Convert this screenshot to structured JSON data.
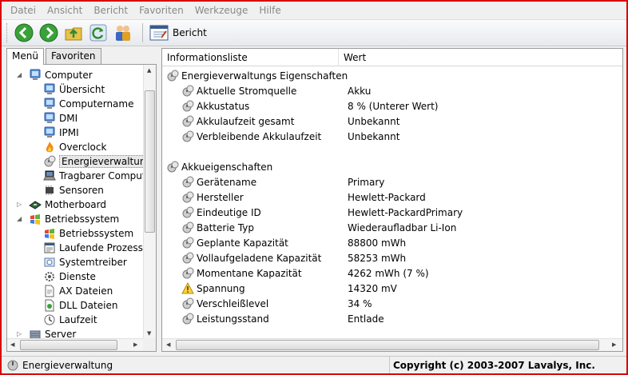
{
  "menubar": [
    "Datei",
    "Ansicht",
    "Bericht",
    "Favoriten",
    "Werkzeuge",
    "Hilfe"
  ],
  "toolbar": {
    "report_label": "Bericht"
  },
  "tabs": {
    "menu": "Menü",
    "favorites": "Favoriten"
  },
  "tree": [
    {
      "label": "Computer",
      "icon": "computer-icon",
      "level": 0,
      "exp": "minus"
    },
    {
      "label": "Übersicht",
      "icon": "computer-icon",
      "level": 1
    },
    {
      "label": "Computername",
      "icon": "computer-icon",
      "level": 1
    },
    {
      "label": "DMI",
      "icon": "computer-icon",
      "level": 1
    },
    {
      "label": "IPMI",
      "icon": "computer-icon",
      "level": 1
    },
    {
      "label": "Overclock",
      "icon": "flame-icon",
      "level": 1
    },
    {
      "label": "Energieverwaltung",
      "icon": "power-icon",
      "level": 1,
      "selected": true
    },
    {
      "label": "Tragbarer Compute",
      "icon": "laptop-icon",
      "level": 1
    },
    {
      "label": "Sensoren",
      "icon": "chip-icon",
      "level": 1
    },
    {
      "label": "Motherboard",
      "icon": "motherboard-icon",
      "level": 0,
      "exp": "plus"
    },
    {
      "label": "Betriebssystem",
      "icon": "windows-icon",
      "level": 0,
      "exp": "minus"
    },
    {
      "label": "Betriebssystem",
      "icon": "windows-icon",
      "level": 1
    },
    {
      "label": "Laufende Prozesse",
      "icon": "process-icon",
      "level": 1
    },
    {
      "label": "Systemtreiber",
      "icon": "driver-icon",
      "level": 1
    },
    {
      "label": "Dienste",
      "icon": "gear-icon",
      "level": 1
    },
    {
      "label": "AX Dateien",
      "icon": "file-icon",
      "level": 1
    },
    {
      "label": "DLL Dateien",
      "icon": "dll-icon",
      "level": 1
    },
    {
      "label": "Laufzeit",
      "icon": "clock-icon",
      "level": 1
    },
    {
      "label": "Server",
      "icon": "server-icon",
      "level": 0,
      "exp": "plus"
    }
  ],
  "list": {
    "col_info": "Informationsliste",
    "col_value": "Wert",
    "rows": [
      {
        "type": "group",
        "label": "Energieverwaltungs Eigenschaften",
        "icon": "power-icon"
      },
      {
        "type": "item",
        "label": "Aktuelle Stromquelle",
        "value": "Akku",
        "icon": "power-icon"
      },
      {
        "type": "item",
        "label": "Akkustatus",
        "value": "8 % (Unterer Wert)",
        "icon": "power-icon"
      },
      {
        "type": "item",
        "label": "Akkulaufzeit gesamt",
        "value": "Unbekannt",
        "icon": "power-icon"
      },
      {
        "type": "item",
        "label": "Verbleibende Akkulaufzeit",
        "value": "Unbekannt",
        "icon": "power-icon"
      },
      {
        "type": "blank"
      },
      {
        "type": "group",
        "label": "Akkueigenschaften",
        "icon": "power-icon"
      },
      {
        "type": "item",
        "label": "Gerätename",
        "value": "Primary",
        "icon": "power-icon"
      },
      {
        "type": "item",
        "label": "Hersteller",
        "value": "Hewlett-Packard",
        "icon": "power-icon"
      },
      {
        "type": "item",
        "label": "Eindeutige ID",
        "value": "Hewlett-PackardPrimary",
        "icon": "power-icon"
      },
      {
        "type": "item",
        "label": "Batterie Typ",
        "value": "Wiederaufladbar Li-Ion",
        "icon": "power-icon"
      },
      {
        "type": "item",
        "label": "Geplante Kapazität",
        "value": "88800 mWh",
        "icon": "power-icon"
      },
      {
        "type": "item",
        "label": "Vollaufgeladene Kapazität",
        "value": "58253 mWh",
        "icon": "power-icon"
      },
      {
        "type": "item",
        "label": "Momentane Kapazität",
        "value": "4262 mWh  (7 %)",
        "icon": "power-icon"
      },
      {
        "type": "item",
        "label": "Spannung",
        "value": "14320 mV",
        "icon": "warning-icon"
      },
      {
        "type": "item",
        "label": "Verschleißlevel",
        "value": "34 %",
        "icon": "power-icon"
      },
      {
        "type": "item",
        "label": "Leistungsstand",
        "value": "Entlade",
        "icon": "power-icon"
      }
    ]
  },
  "status": {
    "left": "Energieverwaltung",
    "right": "Copyright (c) 2003-2007 Lavalys, Inc."
  }
}
